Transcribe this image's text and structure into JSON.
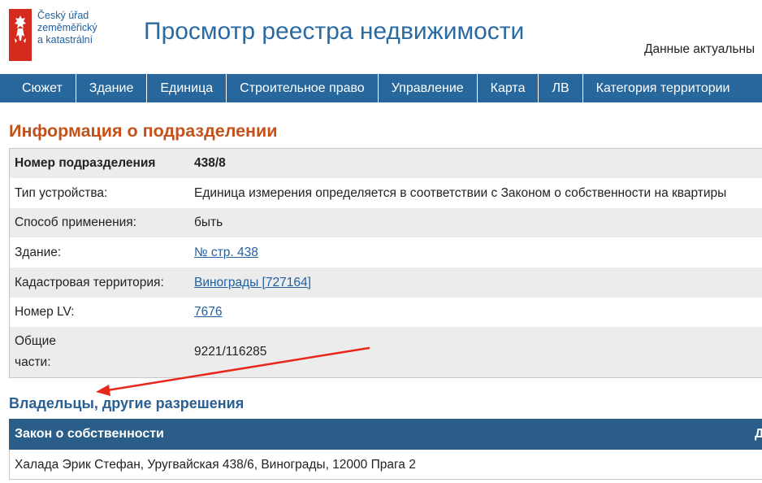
{
  "header": {
    "logo_lines": [
      "Český úřad",
      "zeměměřický",
      "a katastrální"
    ],
    "site_title": "Просмотр реестра недвижимости",
    "data_note": "Данные актуальны"
  },
  "nav": {
    "items": [
      "Сюжет",
      "Здание",
      "Единица",
      "Строительное право",
      "Управление",
      "Карта",
      "ЛВ",
      "Категория территории"
    ]
  },
  "unit_info": {
    "title": "Информация о подразделении",
    "rows": [
      {
        "label": "Номер подразделения",
        "value": "438/8"
      },
      {
        "label": "Тип устройства:",
        "value": "Единица измерения определяется в соответствии с Законом о собственности на квартиры"
      },
      {
        "label": "Способ применения:",
        "value": "быть"
      },
      {
        "label": "Здание:",
        "value": "№ стр. 438"
      },
      {
        "label": "Кадастровая территория:",
        "value": "Винограды [727164]"
      },
      {
        "label": "Номер LV:",
        "value": "7676"
      },
      {
        "label_line1": "Общие",
        "label_line2": "части:",
        "value": "9221/116285"
      }
    ]
  },
  "owners": {
    "title": "Владельцы, другие разрешения",
    "col_ownership": "Закон о собственности",
    "col_share": "Д",
    "rows": [
      {
        "text": "Халада Эрик Стефан, Уругвайская 438/6, Винограды, 12000 Прага 2"
      }
    ]
  },
  "colors": {
    "nav_bg": "#28679b",
    "section_title": "#c5511a",
    "link": "#1f5f9e",
    "annotation_arrow": "#e8261a",
    "logo_red": "#d52b1e"
  }
}
